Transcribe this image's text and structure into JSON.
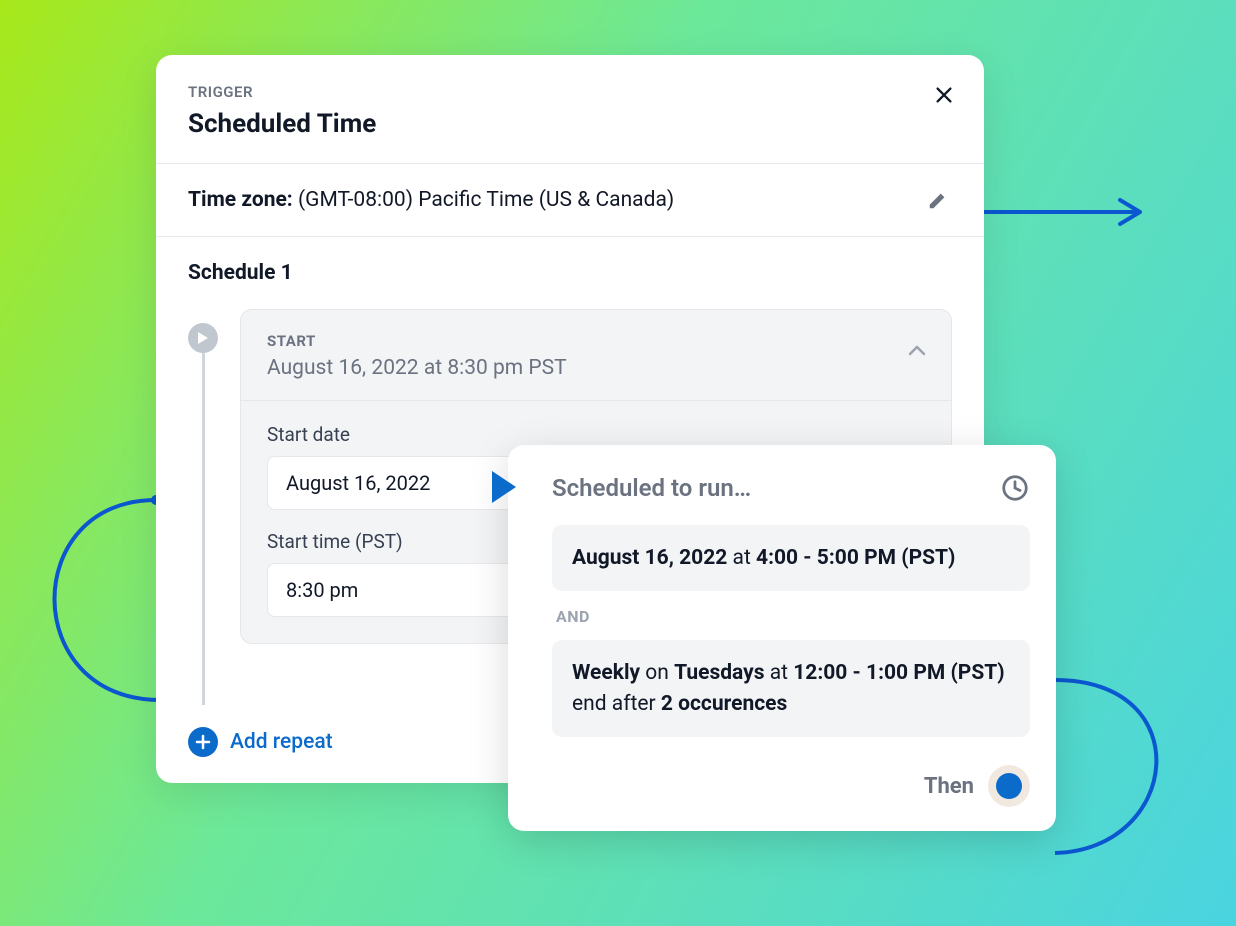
{
  "panel": {
    "eyebrow": "TRIGGER",
    "title": "Scheduled Time",
    "timezone_label": "Time zone:",
    "timezone_value": "(GMT-08:00) Pacific Time (US & Canada)",
    "schedule_heading": "Schedule 1",
    "start": {
      "label": "START",
      "datetime": "August 16, 2022 at 8:30 pm PST",
      "start_date_label": "Start date",
      "start_date_value": "August 16, 2022",
      "start_time_label": "Start time (PST)",
      "start_time_value": "8:30 pm"
    },
    "add_repeat": "Add repeat"
  },
  "scheduled": {
    "title": "Scheduled to run…",
    "entry1": {
      "date": "August 16, 2022",
      "at": " at ",
      "time": "4:00 - 5:00 PM (PST)"
    },
    "and": "AND",
    "entry2": {
      "freq": "Weekly",
      "on": " on ",
      "day": "Tuesdays",
      "at": " at ",
      "time": "12:00 - 1:00 PM (PST)",
      "end": " end after ",
      "count": "2 occurences"
    },
    "then": "Then"
  }
}
